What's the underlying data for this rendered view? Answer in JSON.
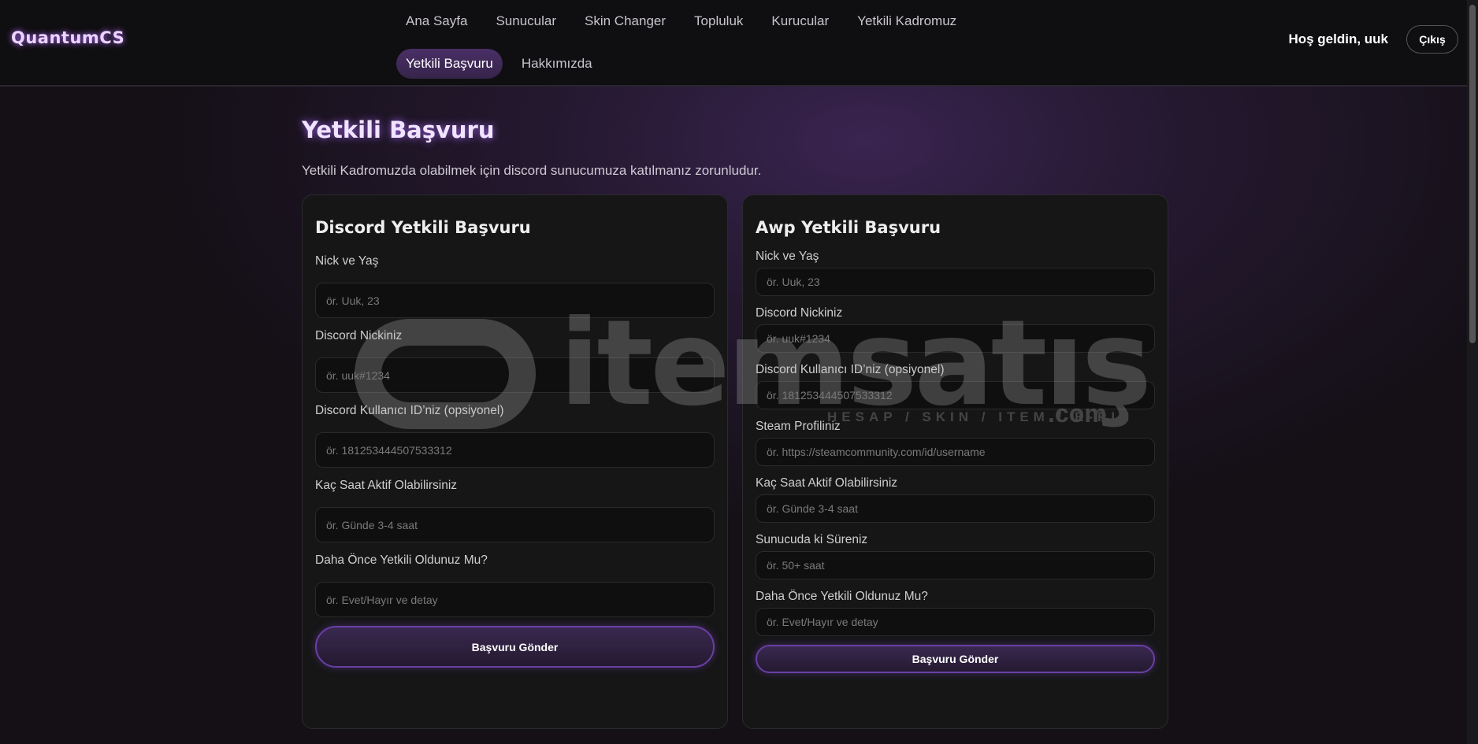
{
  "header": {
    "logo": "QuantumCS",
    "nav": [
      "Ana Sayfa",
      "Sunucular",
      "Skin Changer",
      "Topluluk",
      "Kurucular",
      "Yetkili Kadromuz",
      "Yetkili Başvuru",
      "Hakkımızda"
    ],
    "active": "Yetkili Başvuru",
    "welcome": "Hoş geldin, uuk",
    "logout": "Çıkış"
  },
  "page": {
    "title": "Yetkili Başvuru",
    "subtitle": "Yetkili Kadromuzda olabilmek için discord sunucumuza katılmanız zorunludur."
  },
  "discord_form": {
    "title": "Discord Yetkili Başvuru",
    "fields": [
      {
        "label": "Nick ve Yaş",
        "placeholder": "ör. Uuk, 23"
      },
      {
        "label": "Discord Nickiniz",
        "placeholder": "ör. uuk#1234"
      },
      {
        "label": "Discord Kullanıcı ID’niz (opsiyonel)",
        "placeholder": "ör. 181253444507533312"
      },
      {
        "label": "Kaç Saat Aktif Olabilirsiniz",
        "placeholder": "ör. Günde 3-4 saat"
      },
      {
        "label": "Daha Önce Yetkili Oldunuz Mu?",
        "placeholder": "ör. Evet/Hayır ve detay"
      }
    ],
    "submit": "Başvuru Gönder"
  },
  "awp_form": {
    "title": "Awp Yetkili Başvuru",
    "fields": [
      {
        "label": "Nick ve Yaş",
        "placeholder": "ör. Uuk, 23"
      },
      {
        "label": "Discord Nickiniz",
        "placeholder": "ör. uuk#1234"
      },
      {
        "label": "Discord Kullanıcı ID’niz (opsiyonel)",
        "placeholder": "ör. 181253444507533312"
      },
      {
        "label": "Steam Profiliniz",
        "placeholder": "ör. https://steamcommunity.com/id/username"
      },
      {
        "label": "Kaç Saat Aktif Olabilirsiniz",
        "placeholder": "ör. Günde 3-4 saat"
      },
      {
        "label": "Sunucuda ki Süreniz",
        "placeholder": "ör. 50+ saat"
      },
      {
        "label": "Daha Önce Yetkili Oldunuz Mu?",
        "placeholder": "ör. Evet/Hayır ve detay"
      }
    ],
    "submit": "Başvuru Gönder"
  },
  "watermark": {
    "text": "itemsatış",
    "tagline": "HESAP / SKIN / ITEM / E-PIN",
    "suffix": ".com"
  },
  "colors": {
    "accent": "#6a3fa6",
    "logo_glow": "#b06cff",
    "background": "#141016"
  }
}
